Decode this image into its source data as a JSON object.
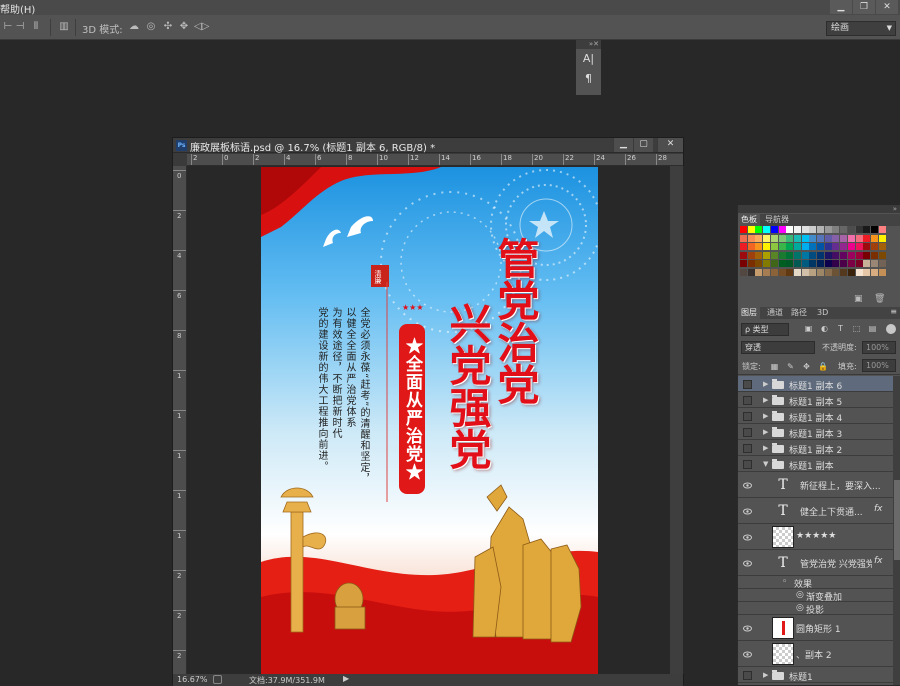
{
  "menu": {
    "help": "帮助(H)"
  },
  "options": {
    "mode_3d": "3D 模式:",
    "workspace": "绘画"
  },
  "char_panel": {
    "char_icon": "A|",
    "para_icon": "¶"
  },
  "document": {
    "title": "廉政展板标语.psd @ 16.7% (标题1 副本 6, RGB/8) *",
    "ps_icon": "Ps",
    "ruler_top_labels": [
      "2",
      "0",
      "2",
      "4",
      "6",
      "8",
      "10",
      "12",
      "14",
      "16",
      "18",
      "20",
      "22",
      "24",
      "26",
      "28"
    ],
    "ruler_left_labels": [
      "0",
      "2",
      "4",
      "6",
      "8",
      "1",
      "1",
      "1",
      "1",
      "1",
      "2",
      "2",
      "2"
    ],
    "zoom": "16.67%",
    "doc_size": "文档:37.9M/351.9M"
  },
  "poster": {
    "slogan_col1": "管党治党",
    "slogan_col2": "兴党强党",
    "banner": "★全面从严治党★",
    "stars": "★★★",
    "seal": "清廉",
    "body_lines": [
      "全党必须永葆“赶考”的清醒和坚定，",
      "以健全全面从严治党体系",
      "为有效途径，不断把新时代",
      "党的建设新的伟大工程推向前进。"
    ]
  },
  "panels": {
    "top_tabs": [
      "色板",
      "导航器"
    ],
    "layer_tabs": [
      "图层",
      "通道",
      "路径",
      "3D"
    ],
    "kind_filter": "ρ 类型",
    "blend_mode": "穿透",
    "opacity_label": "不透明度:",
    "opacity_value": "100%",
    "lock_label": "锁定:",
    "fill_label": "填充:",
    "fill_value": "100%",
    "layers": [
      {
        "name": "标题1 副本 6",
        "type": "group",
        "selected": true
      },
      {
        "name": "标题1 副本 5",
        "type": "group"
      },
      {
        "name": "标题1 副本 4",
        "type": "group"
      },
      {
        "name": "标题1 副本 3",
        "type": "group"
      },
      {
        "name": "标题1 副本 2",
        "type": "group"
      },
      {
        "name": "标题1 副本",
        "type": "group-open"
      },
      {
        "name": "新征程上，要深入...",
        "type": "text"
      },
      {
        "name": "健全上下贯通...",
        "type": "text",
        "fx": "fx"
      },
      {
        "name": "★★★★★",
        "type": "pixel"
      },
      {
        "name": "管党治党 兴党强党",
        "type": "text",
        "fx": "fx"
      },
      {
        "name": "效果",
        "type": "effect-title"
      },
      {
        "name": "渐变叠加",
        "type": "effect"
      },
      {
        "name": "投影",
        "type": "effect"
      },
      {
        "name": "圆角矩形 1",
        "type": "shape"
      },
      {
        "name": "、副本 2",
        "type": "pixel"
      },
      {
        "name": "标题1",
        "type": "group"
      }
    ]
  },
  "colors": {
    "accent_red": "#e20f18",
    "selection_blue": "#5f6b7c"
  }
}
